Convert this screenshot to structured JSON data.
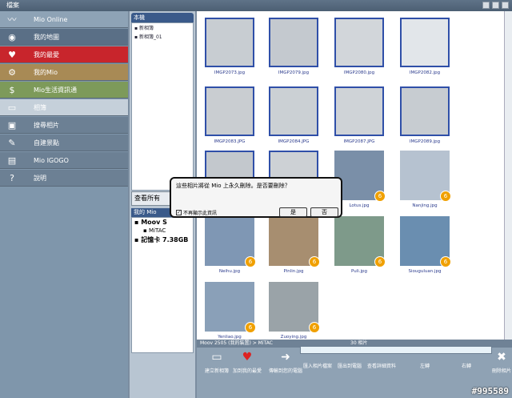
{
  "window": {
    "title": "檔案"
  },
  "sidebar": {
    "items": [
      {
        "label": "Mio Online",
        "icon": "signature-icon"
      },
      {
        "label": "我的地圖",
        "icon": "eye-icon"
      },
      {
        "label": "我的最愛",
        "icon": "heart-icon"
      },
      {
        "label": "我的Mio",
        "icon": "gear-icon"
      },
      {
        "label": "Mio生活資訊通",
        "icon": "dollar-icon"
      },
      {
        "label": "相簿",
        "icon": "photo-album-icon"
      },
      {
        "label": "搜尋相片",
        "icon": "camera-icon"
      },
      {
        "label": "自建景點",
        "icon": "pencil-icon"
      },
      {
        "label": "Mio IGOGO",
        "icon": "book-icon"
      },
      {
        "label": "說明",
        "icon": "question-icon"
      }
    ],
    "colors": [
      "#8ea3b6",
      "#5a6f86",
      "#c8252c",
      "#a88a55",
      "#7d9a5a",
      "#c5d0da",
      "#6c8094",
      "#6c8094",
      "#6c8094",
      "#6c8094"
    ]
  },
  "albums": {
    "header": "本機",
    "items": [
      "新相簿",
      "新相簿_01"
    ],
    "view_all": "查看所有"
  },
  "device": {
    "header": "我的 Mio",
    "items": [
      "Moov S",
      "MiTAC",
      "記憶卡 7.38GB"
    ]
  },
  "photos": [
    {
      "name": "IMGP2073.jpg",
      "badge": ""
    },
    {
      "name": "IMGP2079.jpg",
      "badge": ""
    },
    {
      "name": "IMGP2080.jpg",
      "badge": ""
    },
    {
      "name": "IMGP2082.jpg",
      "badge": ""
    },
    {
      "name": "IMGP2083.JPG",
      "badge": ""
    },
    {
      "name": "IMGP2084.JPG",
      "badge": ""
    },
    {
      "name": "IMGP2087.JPG",
      "badge": ""
    },
    {
      "name": "IMGP2089.jpg",
      "badge": ""
    },
    {
      "name": "",
      "badge": ""
    },
    {
      "name": "",
      "badge": ""
    },
    {
      "name": "Lotus.jpg",
      "badge": "6"
    },
    {
      "name": "Nanjing.jpg",
      "badge": "6"
    },
    {
      "name": "Neihu.jpg",
      "badge": "6"
    },
    {
      "name": "Pinlin.jpg",
      "badge": "6"
    },
    {
      "name": "Puli.jpg",
      "badge": "6"
    },
    {
      "name": "Siouguluan.jpg",
      "badge": "6"
    },
    {
      "name": "Yenliao.jpg",
      "badge": "6"
    },
    {
      "name": "Zuoying.jpg",
      "badge": "6"
    }
  ],
  "statusbar": {
    "path": "Moov 2505 (我的裝置) > MiTAC",
    "count": "30 相片"
  },
  "toolbar": [
    {
      "label": "建立新相簿",
      "icon": "new-album-icon"
    },
    {
      "label": "加到我的最愛",
      "icon": "add-favorite-icon"
    },
    {
      "label": "傳輸到您的電腦",
      "icon": "transfer-icon"
    },
    {
      "label": "匯入相片檔案",
      "icon": "import-icon"
    },
    {
      "label": "匯出到電腦",
      "icon": "export-icon"
    },
    {
      "label": "查看詳細資料",
      "icon": "details-icon"
    },
    {
      "label": "左轉",
      "icon": "rotate-left-icon"
    },
    {
      "label": "右轉",
      "icon": "rotate-right-icon"
    },
    {
      "label": "刪除相片",
      "icon": "delete-photo-icon"
    }
  ],
  "dialog": {
    "message": "這些相片將從 Mio 上永久刪除。是否要刪除？",
    "checkbox_label": "不再顯示此資訊",
    "checkbox_checked": "✓",
    "yes": "是",
    "no": "否"
  },
  "watermark": "#995589"
}
